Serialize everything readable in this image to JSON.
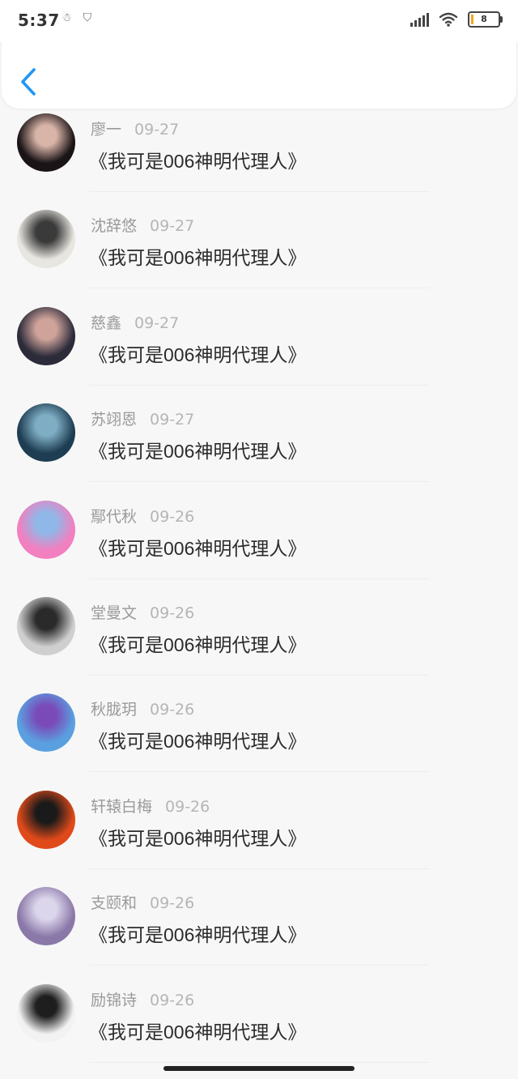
{
  "status_bar": {
    "time": "5:37",
    "battery": "8"
  },
  "nav": {
    "back_icon": "chevron-left-icon"
  },
  "colors": {
    "accent": "#2196F3"
  },
  "comments": [
    {
      "name": "廖一",
      "date": "09-27",
      "text": "《我可是006神明代理人》",
      "avatar_colors": [
        "#1a1416",
        "#d9b4a8"
      ]
    },
    {
      "name": "沈辞悠",
      "date": "09-27",
      "text": "《我可是006神明代理人》",
      "avatar_colors": [
        "#e8e6e0",
        "#3a3a3a"
      ]
    },
    {
      "name": "慈鑫",
      "date": "09-27",
      "text": "《我可是006神明代理人》",
      "avatar_colors": [
        "#2b2b3a",
        "#cfa39a"
      ]
    },
    {
      "name": "苏翊恩",
      "date": "09-27",
      "text": "《我可是006神明代理人》",
      "avatar_colors": [
        "#1e3d52",
        "#7faec4"
      ]
    },
    {
      "name": "鄢代秋",
      "date": "09-26",
      "text": "《我可是006神明代理人》",
      "avatar_colors": [
        "#f27fc0",
        "#8fb8e8"
      ]
    },
    {
      "name": "堂曼文",
      "date": "09-26",
      "text": "《我可是006神明代理人》",
      "avatar_colors": [
        "#cfcfcf",
        "#2a2a2a"
      ]
    },
    {
      "name": "秋胧玥",
      "date": "09-26",
      "text": "《我可是006神明代理人》",
      "avatar_colors": [
        "#5aa0e0",
        "#7a4ab8"
      ]
    },
    {
      "name": "轩辕白梅",
      "date": "09-26",
      "text": "《我可是006神明代理人》",
      "avatar_colors": [
        "#e04a1a",
        "#1a1a1a"
      ]
    },
    {
      "name": "支颐和",
      "date": "09-26",
      "text": "《我可是006神明代理人》",
      "avatar_colors": [
        "#8a78a8",
        "#dcd6ec"
      ]
    },
    {
      "name": "励锦诗",
      "date": "09-26",
      "text": "《我可是006神明代理人》",
      "avatar_colors": [
        "#f2f2f2",
        "#1e1e1e"
      ]
    }
  ]
}
